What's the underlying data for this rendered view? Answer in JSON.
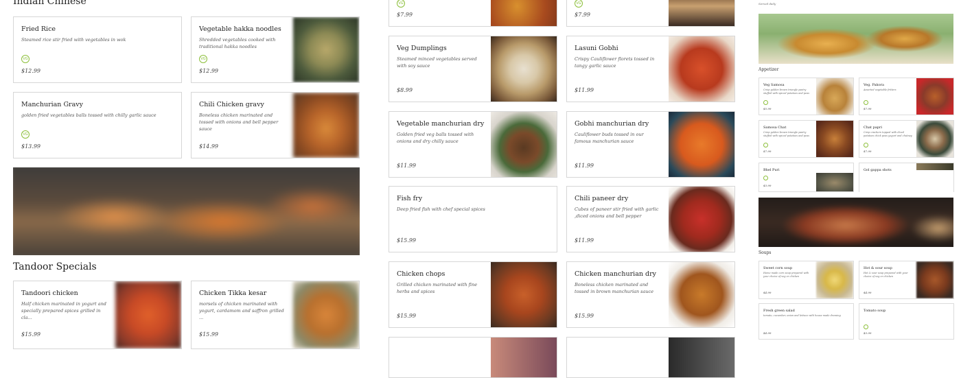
{
  "left": {
    "section1_title": "Indian Chinese",
    "section2_title": "Tandoor Specials",
    "items": [
      {
        "name": "Fried Rice",
        "desc": "Steamed rice stir fried with vegetables in wok",
        "price": "$12.99",
        "veg": "VG"
      },
      {
        "name": "Vegetable hakka noodles",
        "desc": "Shredded vegetables cooked with traditional hakka noodles",
        "price": "$12.99",
        "veg": "VG"
      },
      {
        "name": "Manchurian Gravy",
        "desc": "golden fried vegetables balls tossed with chilly garlic sauce",
        "price": "$13.99",
        "veg": "VG"
      },
      {
        "name": "Chili Chicken gravy",
        "desc": "Boneless chicken marinated and tossed with onions and bell pepper sauce",
        "price": "$14.99"
      },
      {
        "name": "Tandoori chicken",
        "desc": "Half chicken marinated in yogurt and specially prepared spices grilled in cla...",
        "price": "$15.99"
      },
      {
        "name": "Chicken Tikka kesar",
        "desc": "morsels of chicken marinated with yogurt, cardamom and saffron grilled ...",
        "price": "$15.99"
      }
    ]
  },
  "middle": {
    "items": [
      {
        "name": "",
        "desc": "",
        "price": "$7.99",
        "veg": "VG"
      },
      {
        "name": "",
        "desc": "",
        "price": "$7.99",
        "veg": "VG"
      },
      {
        "name": "Veg Dumplings",
        "desc": "Steamed minced vegetables served with soy sauce",
        "price": "$8.99"
      },
      {
        "name": "Lasuni Gobhi",
        "desc": "Crispy Cauliflower florets tossed in tangy garlic sauce",
        "price": "$11.99"
      },
      {
        "name": "Vegetable manchurian dry",
        "desc": "Golden fried veg balls tossed with onions and dry chilly sauce",
        "price": "$11.99"
      },
      {
        "name": "Gobhi manchurian dry",
        "desc": "Cauliflower buds tossed in our famous manchurian sauce",
        "price": "$11.99"
      },
      {
        "name": "Fish fry",
        "desc": "Deep fried fish with chef special spices",
        "price": "$15.99"
      },
      {
        "name": "Chili paneer dry",
        "desc": "Cubes of paneer stir fried with garlic ,diced onions and bell pepper",
        "price": "$11.99"
      },
      {
        "name": "Chicken chops",
        "desc": "Grilled chicken marinated with fine herbs and spices",
        "price": "$15.99"
      },
      {
        "name": "Chicken manchurian dry",
        "desc": "Boneless chicken marinated and tossed in brown manchurian sauce",
        "price": "$15.99"
      }
    ]
  },
  "right": {
    "served_daily": "Served daily",
    "appetizer_title": "Appetizer",
    "soups_title": "Soups",
    "appetizers": [
      {
        "name": "Veg Samosa",
        "desc": "Crisp golden brown triangle pastry stuffed with spiced potatoes and peas",
        "price": "$5.99"
      },
      {
        "name": "Veg. Pakora",
        "desc": "Assorted vegetable fritters",
        "price": "$7.99"
      },
      {
        "name": "Samosa Chat",
        "desc": "Crisp golden brown triangle pastry stuffed with spiced potatoes and peas",
        "price": "$7.99"
      },
      {
        "name": "Chat papri",
        "desc": "Crisp crackers topped with diced potatoes chick peas yogurt and chutney",
        "price": "$7.99"
      },
      {
        "name": "Bhel Puri",
        "desc": "",
        "price": "$3.99"
      },
      {
        "name": "Gol gappa shots",
        "desc": "",
        "price": ""
      }
    ],
    "soups": [
      {
        "name": "Sweet corn soup",
        "desc": "Home made corn soup prepared with your choice of veg or chicken",
        "price": "$4.99"
      },
      {
        "name": "Hot & sour soup",
        "desc": "Hot & sour soup prepared with your choice of veg or chicken",
        "price": "$4.99"
      },
      {
        "name": "Fresh green salad",
        "desc": "tomato, cucumber, onion and lettuce with house made dressing",
        "price": "$4.99"
      },
      {
        "name": "Tomato soup",
        "desc": "",
        "price": "$3.99"
      }
    ]
  }
}
